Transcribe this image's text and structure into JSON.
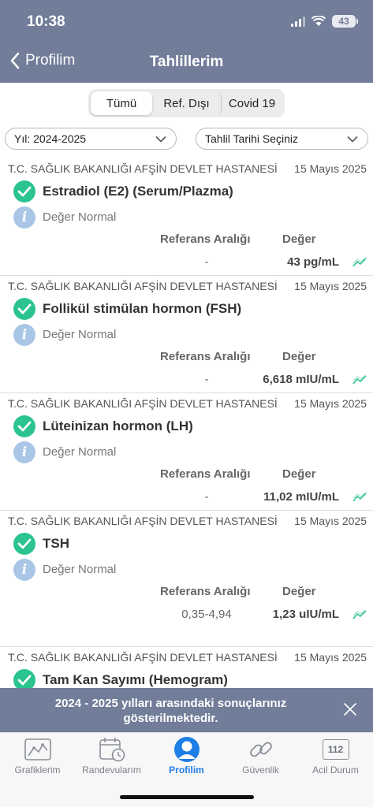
{
  "status_bar": {
    "time": "10:38",
    "battery": "43"
  },
  "nav": {
    "back_label": "Profilim",
    "title": "Tahlillerim"
  },
  "segments": [
    "Tümü",
    "Ref. Dışı",
    "Covid 19"
  ],
  "filters": {
    "year": "Yıl: 2024-2025",
    "date": "Tahlil Tarihi Seçiniz"
  },
  "labels": {
    "ref_header": "Referans Aralığı",
    "value_header": "Değer"
  },
  "results": [
    {
      "hospital": "T.C. SAĞLIK BAKANLIĞI AFŞİN DEVLET HASTANESİ",
      "date": "15 Mayıs 2025",
      "name": "Estradiol (E2) (Serum/Plazma)",
      "status": "Değer Normal",
      "ref": "-",
      "value": "43 pg/mL"
    },
    {
      "hospital": "T.C. SAĞLIK BAKANLIĞI AFŞİN DEVLET HASTANESİ",
      "date": "15 Mayıs 2025",
      "name": "Follikül stimülan hormon (FSH)",
      "status": "Değer Normal",
      "ref": "-",
      "value": "6,618 mIU/mL"
    },
    {
      "hospital": "T.C. SAĞLIK BAKANLIĞI AFŞİN DEVLET HASTANESİ",
      "date": "15 Mayıs 2025",
      "name": "Lüteinizan hormon (LH)",
      "status": "Değer Normal",
      "ref": "-",
      "value": "11,02 mIU/mL"
    },
    {
      "hospital": "T.C. SAĞLIK BAKANLIĞI AFŞİN DEVLET HASTANESİ",
      "date": "15 Mayıs 2025",
      "name": "TSH",
      "status": "Değer Normal",
      "ref": "0,35-4,94",
      "value": "1,23 uIU/mL"
    },
    {
      "hospital": "T.C. SAĞLIK BAKANLIĞI AFŞİN DEVLET HASTANESİ",
      "date": "15 Mayıs 2025",
      "name": "Tam Kan Sayımı (Hemogram)"
    }
  ],
  "banner": {
    "text": "2024 - 2025 yılları arasındaki sonuçlarınız gösterilmektedir."
  },
  "tabs": [
    {
      "label": "Grafiklerim",
      "icon": "chart-icon"
    },
    {
      "label": "Randevularım",
      "icon": "calendar-clock-icon"
    },
    {
      "label": "Profilim",
      "icon": "user-icon"
    },
    {
      "label": "Güvenlik",
      "icon": "link-icon"
    },
    {
      "label": "Acil Durum",
      "icon": "emergency-112-icon",
      "badge": "112"
    }
  ],
  "colors": {
    "header": "#717d99",
    "check": "#2bc48e",
    "info": "#a9c6e6",
    "active_tab": "#1f7de6"
  }
}
